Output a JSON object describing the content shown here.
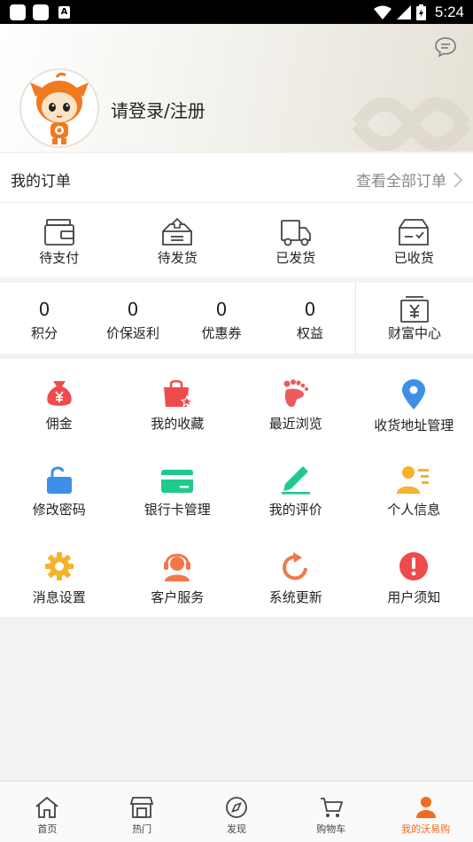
{
  "status_bar": {
    "time": "5:24",
    "app_icon_letter": "A"
  },
  "profile": {
    "login_text": "请登录/注册",
    "avatar_icon": "mascot-avatar-icon",
    "message_icon": "chat-bubble-icon"
  },
  "orders": {
    "title": "我的订单",
    "view_all": "查看全部订单",
    "items": [
      {
        "label": "待支付",
        "icon": "wallet-icon"
      },
      {
        "label": "待发货",
        "icon": "box-upload-icon"
      },
      {
        "label": "已发货",
        "icon": "truck-icon"
      },
      {
        "label": "已收货",
        "icon": "box-check-icon"
      }
    ]
  },
  "stats": {
    "items": [
      {
        "value": "0",
        "label": "积分"
      },
      {
        "value": "0",
        "label": "价保返利"
      },
      {
        "value": "0",
        "label": "优惠券"
      },
      {
        "value": "0",
        "label": "权益"
      }
    ],
    "wealth_label": "财富中心"
  },
  "tools": [
    {
      "label": "佣金",
      "icon": "money-bag-icon",
      "color": "#ef4b4b"
    },
    {
      "label": "我的收藏",
      "icon": "favorite-bag-icon",
      "color": "#ef4b4b"
    },
    {
      "label": "最近浏览",
      "icon": "footprint-icon",
      "color": "#ef5a5a"
    },
    {
      "label": "收货地址管理",
      "icon": "location-pin-icon",
      "color": "#3d8fe8"
    },
    {
      "label": "修改密码",
      "icon": "unlock-icon",
      "color": "#3d8fe8"
    },
    {
      "label": "银行卡管理",
      "icon": "bank-card-icon",
      "color": "#20c98c"
    },
    {
      "label": "我的评价",
      "icon": "pen-icon",
      "color": "#20c98c"
    },
    {
      "label": "个人信息",
      "icon": "user-card-icon",
      "color": "#f5b22c"
    },
    {
      "label": "消息设置",
      "icon": "gear-icon",
      "color": "#f5b22c"
    },
    {
      "label": "客户服务",
      "icon": "customer-service-icon",
      "color": "#f2774a"
    },
    {
      "label": "系统更新",
      "icon": "refresh-icon",
      "color": "#f2774a"
    },
    {
      "label": "用户须知",
      "icon": "alert-icon",
      "color": "#ef4b4b"
    }
  ],
  "tabs": [
    {
      "label": "首页",
      "icon": "home-icon"
    },
    {
      "label": "热门",
      "icon": "store-icon"
    },
    {
      "label": "发现",
      "icon": "compass-icon"
    },
    {
      "label": "购物车",
      "icon": "cart-icon"
    },
    {
      "label": "我的沃易购",
      "icon": "user-icon",
      "active": true
    }
  ],
  "colors": {
    "accent": "#f26b1d",
    "background": "#f2f2f4"
  }
}
